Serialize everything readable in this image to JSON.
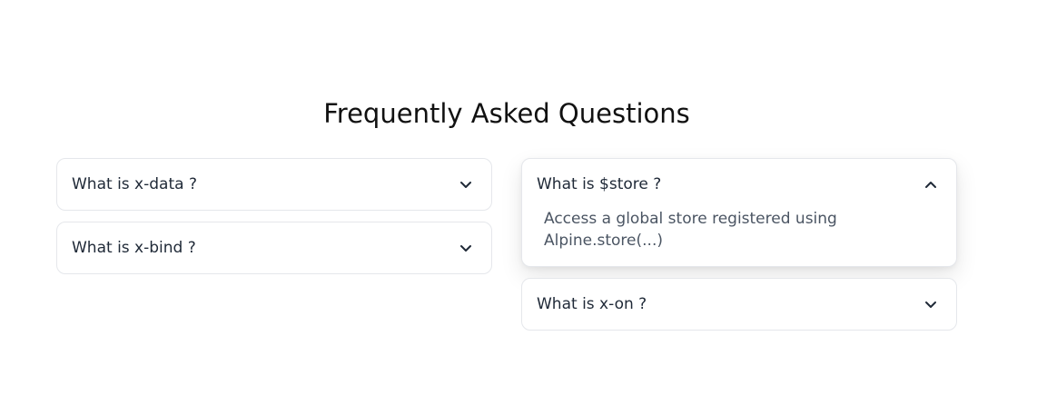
{
  "title": "Frequently Asked Questions",
  "left_column": [
    {
      "question": "What is x-data ?",
      "expanded": false
    },
    {
      "question": "What is x-bind ?",
      "expanded": false
    }
  ],
  "right_column": [
    {
      "question": "What is $store ?",
      "expanded": true,
      "answer": "Access a global store registered using Alpine.store(...)"
    },
    {
      "question": "What is x-on ?",
      "expanded": false
    }
  ],
  "icons": {
    "collapsed": "chevron-down-icon",
    "expanded": "chevron-up-icon"
  },
  "colors": {
    "text": "#1f2937",
    "answer_text": "#4b5563",
    "border": "#e5e7eb"
  }
}
